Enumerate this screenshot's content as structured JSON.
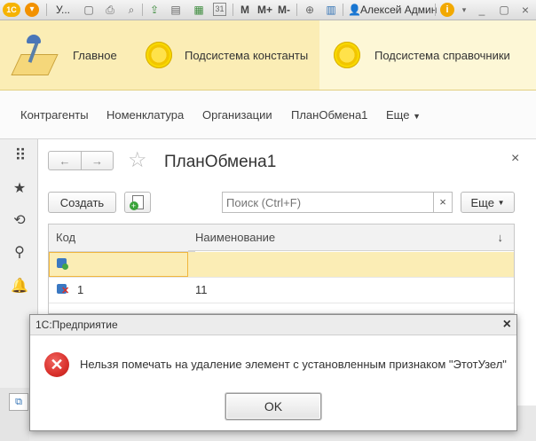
{
  "titlebar": {
    "app_logo": "1С",
    "title_short": "У...",
    "memory_buttons": [
      "M",
      "M+",
      "M-"
    ],
    "user_name": "Алексей Админ"
  },
  "sections": [
    {
      "label": "Главное",
      "icon": "desk-lamp-icon"
    },
    {
      "label": "Подсистема константы",
      "icon": "yellow-circle-icon"
    },
    {
      "label": "Подсистема справочники",
      "icon": "yellow-circle-icon"
    }
  ],
  "nav": {
    "items": [
      "Контрагенты",
      "Номенклатура",
      "Организации",
      "ПланОбмена1"
    ],
    "more": "Еще"
  },
  "form": {
    "title": "ПланОбмена1",
    "create_button": "Создать",
    "search_placeholder": "Поиск (Ctrl+F)",
    "more_button": "Еще",
    "columns": [
      "Код",
      "Наименование"
    ],
    "rows": [
      {
        "code": "",
        "name": "",
        "selected": true,
        "icon": "exchange-node-icon"
      },
      {
        "code": "1",
        "name": "11",
        "selected": false,
        "icon": "exchange-node-marked-deleted-icon"
      }
    ]
  },
  "dialog": {
    "title": "1С:Предприятие",
    "message": "Нельзя помечать на удаление элемент с установленным признаком \"ЭтотУзел\"",
    "ok": "OK"
  },
  "colors": {
    "sections_bg": "#fbedb5",
    "selected_row": "#fbedb5",
    "error_red": "#d9302b"
  }
}
